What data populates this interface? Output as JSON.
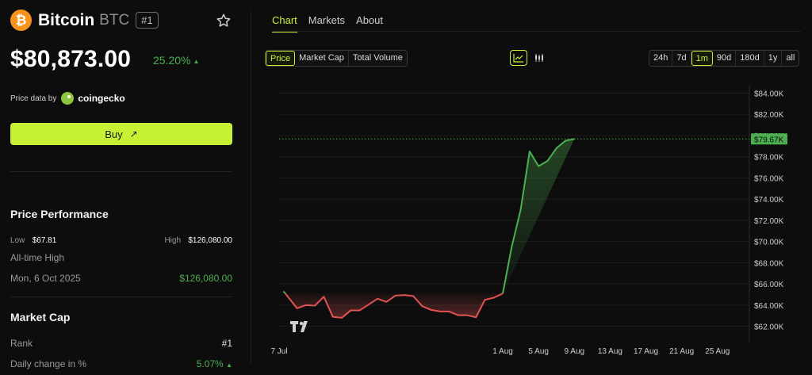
{
  "coin": {
    "logo_glyph": "₿",
    "name": "Bitcoin",
    "symbol": "BTC",
    "rank_badge": "#1",
    "price": "$80,873.00",
    "change": "25.20%",
    "change_arrow": "▲",
    "price_data_label": "Price data by",
    "price_data_source": "coingecko",
    "buy_label": "Buy",
    "buy_arrow": "↗"
  },
  "performance": {
    "title": "Price Performance",
    "low_label": "Low",
    "low_value": "$67.81",
    "high_label": "High",
    "high_value": "$126,080.00",
    "ath_label": "All-time High",
    "ath_date": "Mon, 6 Oct 2025",
    "ath_value": "$126,080.00"
  },
  "market_cap": {
    "title": "Market Cap",
    "rank_label": "Rank",
    "rank_value": "#1",
    "daily_change_label": "Daily change in %",
    "daily_change_value": "5.07%",
    "daily_change_arrow": "▲"
  },
  "tabs": [
    "Chart",
    "Markets",
    "About"
  ],
  "metric_options": [
    "Price",
    "Market Cap",
    "Total Volume"
  ],
  "selected_metric": "Price",
  "chart_types": [
    "line-chart-icon",
    "candlestick-icon"
  ],
  "ranges": [
    "24h",
    "7d",
    "1m",
    "90d",
    "180d",
    "1y",
    "all"
  ],
  "selected_range": "1m",
  "colors": {
    "accent": "#c6f135",
    "up": "#4caf50",
    "down": "#e05353",
    "bitcoin": "#f7931a"
  },
  "chart_data": {
    "type": "line",
    "y_unit": "USD",
    "current_price_label": "$79.67K",
    "current_price": 79670,
    "reference_price": 65100,
    "ylim": [
      61000,
      84700
    ],
    "y_ticks": [
      "$84.00K",
      "$82.00K",
      "$80.00K",
      "$78.00K",
      "$76.00K",
      "$74.00K",
      "$72.00K",
      "$70.00K",
      "$68.00K",
      "$66.00K",
      "$64.00K",
      "$62.00K"
    ],
    "y_tick_values": [
      84000,
      82000,
      80000,
      78000,
      76000,
      74000,
      72000,
      70000,
      68000,
      66000,
      64000,
      62000
    ],
    "x_ticks": [
      "7 Jul",
      "1 Aug",
      "5 Aug",
      "9 Aug",
      "13 Aug",
      "17 Aug",
      "21 Aug",
      "25 Aug"
    ],
    "x_tick_days": [
      0,
      25,
      29,
      33,
      37,
      41,
      45,
      49
    ],
    "x_range_days": [
      0,
      51.5
    ],
    "x": [
      0.5,
      2,
      3,
      4,
      5,
      6,
      7,
      8,
      9,
      10,
      11,
      12,
      13,
      14,
      15,
      16,
      17,
      18,
      19,
      20,
      21,
      22,
      23,
      24,
      25,
      26,
      27,
      28,
      29,
      30,
      31,
      32,
      33,
      34,
      35,
      36,
      37,
      38,
      39,
      40,
      41,
      42,
      43,
      44,
      45,
      46,
      47,
      48,
      49,
      50,
      51.3
    ],
    "values": [
      65300,
      63700,
      64000,
      63950,
      64800,
      62900,
      62800,
      63500,
      63500,
      64050,
      64600,
      64300,
      64900,
      64950,
      64850,
      63900,
      63550,
      63400,
      63400,
      63050,
      63050,
      62850,
      64500,
      64700,
      65100,
      69500,
      73000,
      78500,
      77100,
      77600,
      78800,
      79500,
      79670
    ]
  }
}
